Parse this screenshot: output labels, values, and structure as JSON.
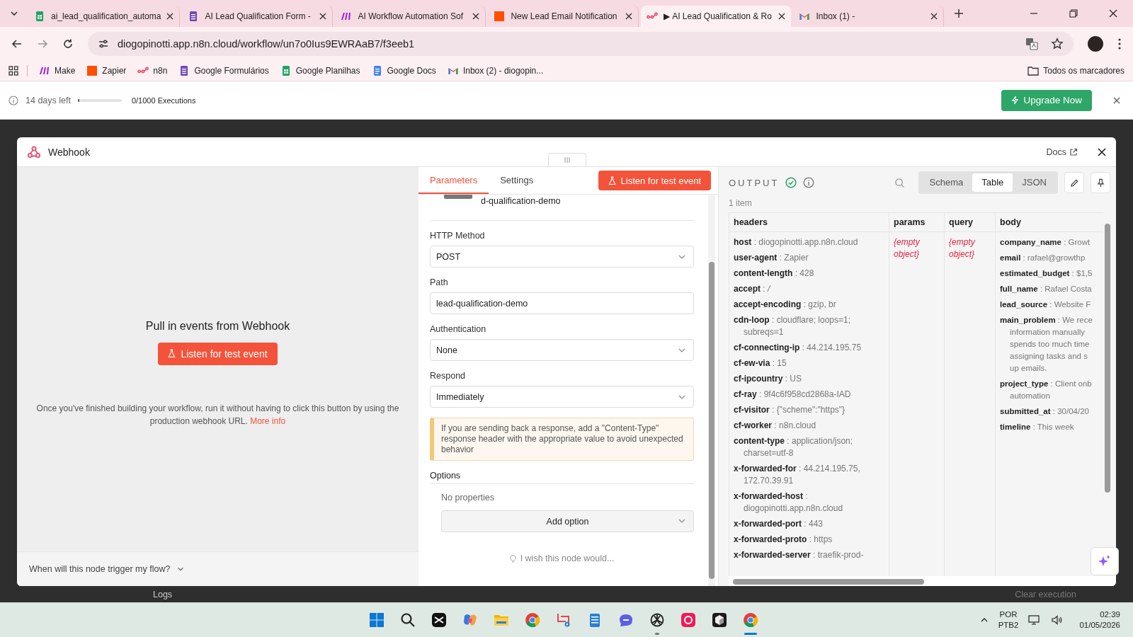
{
  "browser": {
    "tabs": [
      {
        "kind": "sheets",
        "title": "ai_lead_qualification_automa",
        "selected": false
      },
      {
        "kind": "forms",
        "title": "AI Lead Qualification Form -",
        "selected": false
      },
      {
        "kind": "make",
        "title": "AI Workflow Automation Sof",
        "selected": false
      },
      {
        "kind": "zapier",
        "title": "New Lead Email Notification",
        "selected": false
      },
      {
        "kind": "n8n",
        "title": "▶ AI Lead Qualification & Ro",
        "selected": true
      },
      {
        "kind": "gmail",
        "title": "Inbox (1) -",
        "selected": false
      }
    ],
    "url": "diogopinotti.app.n8n.cloud/workflow/un7o0Ius9EWRAaB7/f3eeb1",
    "bookmarks": [
      {
        "kind": "make",
        "label": "Make"
      },
      {
        "kind": "zapier",
        "label": "Zapier"
      },
      {
        "kind": "n8n",
        "label": "n8n"
      },
      {
        "kind": "forms",
        "label": "Google Formulários"
      },
      {
        "kind": "sheets",
        "label": "Google Planilhas"
      },
      {
        "kind": "docs",
        "label": "Google Docs"
      },
      {
        "kind": "gmail",
        "label": "Inbox (2) - diogopin..."
      }
    ],
    "all_bookmarks": "Todos os marcadores"
  },
  "trial_banner": {
    "days_left": "14 days left",
    "level": 0.02,
    "executions": "0/1000 Executions",
    "button": "Upgrade Now"
  },
  "modal": {
    "title": "Webhook",
    "docs_link": "Docs"
  },
  "left_panel": {
    "heading": "Pull in events from Webhook",
    "button": "Listen for test event",
    "description": "Once you've finished building your workflow, run it without having to click this button by using the production webhook URL.",
    "link": "More info",
    "footer": "When will this node trigger my flow?"
  },
  "parameters": {
    "tabs": [
      {
        "label": "Parameters",
        "selected": true
      },
      {
        "label": "Settings",
        "selected": false
      }
    ],
    "listen_button": "Listen for test event",
    "path_preview": "d-qualification-demo",
    "fields": [
      {
        "label": "HTTP Method",
        "kind": "select",
        "value": "POST"
      },
      {
        "label": "Path",
        "kind": "text",
        "value": "lead-qualification-demo"
      },
      {
        "label": "Authentication",
        "kind": "select",
        "value": "None"
      },
      {
        "label": "Respond",
        "kind": "select",
        "value": "Immediately"
      }
    ],
    "notice": "If you are sending back a response, add a \"Content-Type\" response header with the appropriate value to avoid unexpected behavior",
    "options_label": "Options",
    "no_properties": "No properties",
    "add_option": "Add option",
    "feedback": "I wish this node would..."
  },
  "output": {
    "title": "OUTPUT",
    "views": [
      {
        "label": "Schema",
        "selected": false
      },
      {
        "label": "Table",
        "selected": true
      },
      {
        "label": "JSON",
        "selected": false
      }
    ],
    "item_count": "1 item",
    "columns": [
      "headers",
      "params",
      "query",
      "body"
    ],
    "headers": [
      "**host** : diogopinotti.app.n8n.cloud",
      "**user-agent** : Zapier",
      "**content-length** : 428",
      "**accept** : */*",
      "**accept-encoding** : gzip, br",
      "**cdn-loop** : cloudflare; loops=1; subreqs=1",
      "**cf-connecting-ip** : 44.214.195.75",
      "**cf-ew-via** : 15",
      "**cf-ipcountry** : US",
      "**cf-ray** : 9f4c6f958cd2868a-IAD",
      "**cf-visitor** : {\"scheme\":\"https\"}",
      "**cf-worker** : n8n.cloud",
      "**content-type** : application/json; charset=utf-8",
      "**x-forwarded-for** : 44.214.195.75, 172.70.39.91",
      "**x-forwarded-host** : diogopinotti.app.n8n.cloud",
      "**x-forwarded-port** : 443",
      "**x-forwarded-proto** : https",
      "**x-forwarded-server** : traefik-prod-"
    ],
    "params": "{empty object}",
    "query": "{empty object}",
    "body": [
      {
        "text": "**company_name** : Growt"
      },
      {
        "text": "**email** : rafael@growthp"
      },
      {
        "text": "**estimated_budget** : $1,5"
      },
      {
        "text": "**full_name** : Rafael Costa"
      },
      {
        "text": "**lead_source** : Website F"
      },
      {
        "text": "**main_problem** : We rece",
        "continued": [
          "information manually",
          "spends too much time",
          "assigning tasks and s",
          "up emails."
        ]
      },
      {
        "text": "**project_type** : Client onb",
        "continued": [
          "automation"
        ]
      },
      {
        "text": "**submitted_at** : 30/04/20"
      },
      {
        "text": "**timeline** : This week"
      }
    ]
  },
  "background": {
    "logs": "Logs",
    "clear_execution": "Clear execution"
  },
  "taskbar": {
    "apps": [
      {
        "kind": "start",
        "open": false,
        "selected": false
      },
      {
        "kind": "search",
        "open": false,
        "selected": false
      },
      {
        "kind": "capcut",
        "open": false,
        "selected": false
      },
      {
        "kind": "copilot",
        "open": false,
        "selected": false
      },
      {
        "kind": "folder",
        "open": false,
        "selected": false
      },
      {
        "kind": "chrome",
        "open": false,
        "selected": false
      },
      {
        "kind": "snip",
        "open": false,
        "selected": false
      },
      {
        "kind": "notepad",
        "open": false,
        "selected": false
      },
      {
        "kind": "blue",
        "open": false,
        "selected": false
      },
      {
        "kind": "chatgpt",
        "open": true,
        "selected": false
      },
      {
        "kind": "adobe",
        "open": false,
        "selected": false
      },
      {
        "kind": "cube",
        "open": false,
        "selected": false
      },
      {
        "kind": "chrome",
        "open": true,
        "selected": true
      }
    ],
    "language": "POR",
    "layout": "PTB2",
    "time": "02:39",
    "date": "01/05/2026"
  }
}
